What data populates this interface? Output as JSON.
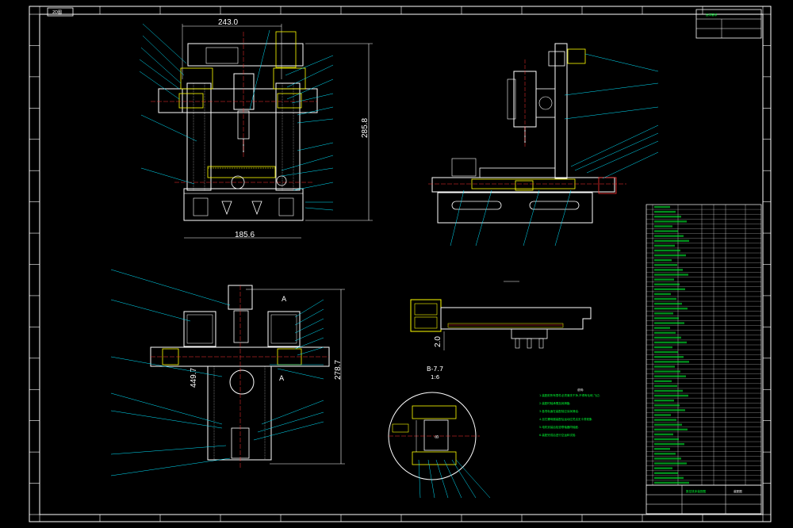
{
  "title_box": {
    "label": "2D图"
  },
  "dimensions": {
    "front_width": "243.0",
    "front_height": "285.8",
    "front_base": "185.6",
    "lower_height": "278.7",
    "lower_left": "449.7",
    "detail_dim": "2.0"
  },
  "section": {
    "a_label": "A",
    "b_label": "B-7.7",
    "b_scale": "1:6",
    "bb_label": "B"
  },
  "notes": {
    "heading": "说明:",
    "lines": [
      "1.装配前所有零件必须清洗干净,不得有毛刺,飞边.",
      "2.装配时轴承需加润滑脂.",
      "3.各导轨面在装配前应涂润滑油.",
      "4.丝杠螺母副装配后运动应灵活无卡滞现象.",
      "5.电机安装后检查联轴器同轴度.",
      "6.装配完成后进行空运转试验."
    ]
  },
  "title_block": {
    "company": "数控铣床装配图",
    "drawing_no": "装配图",
    "top_right": "技术要求"
  },
  "colors": {
    "line": "#ffffff",
    "accent": "#ff3030",
    "part": "#ffff00",
    "leader": "#00e5ff",
    "green": "#00ff33",
    "frame": "#ffffff"
  }
}
